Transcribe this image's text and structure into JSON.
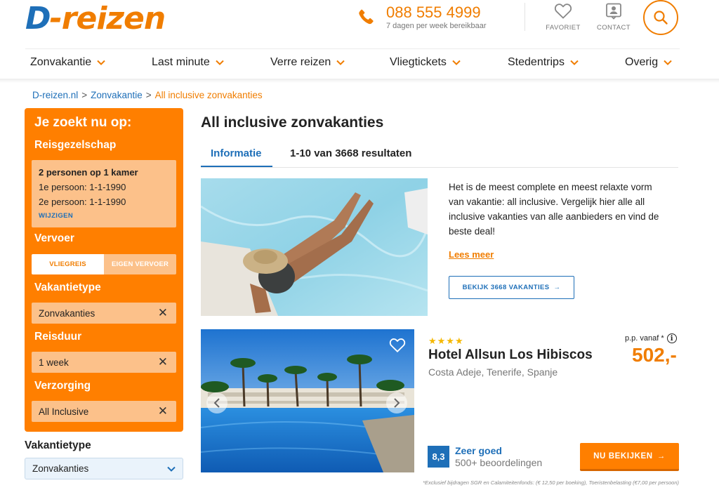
{
  "header": {
    "logo_d": "D",
    "logo_rest": "-reizen",
    "phone_number": "088 555 4999",
    "phone_sub": "7 dagen per week bereikbaar",
    "favorites_label": "FAVORIET",
    "contact_label": "CONTACT",
    "icons": [
      "phone-icon",
      "heart-icon",
      "contact-icon",
      "search-icon"
    ]
  },
  "nav": {
    "items": [
      {
        "label": "Zonvakantie"
      },
      {
        "label": "Last minute"
      },
      {
        "label": "Verre reizen"
      },
      {
        "label": "Vliegtickets"
      },
      {
        "label": "Stedentrips"
      },
      {
        "label": "Overig"
      }
    ]
  },
  "breadcrumb": {
    "items": [
      "D-reizen.nl",
      "Zonvakantie",
      "All inclusive zonvakanties"
    ],
    "separator": ">"
  },
  "sidebar": {
    "heading": "Je zoekt nu op:",
    "party": {
      "title": "Reisgezelschap",
      "summary": "2 personen op 1 kamer",
      "person1": "1e persoon: 1-1-1990",
      "person2": "2e persoon: 1-1-1990",
      "change_label": "WIJZIGEN"
    },
    "transport": {
      "title": "Vervoer",
      "options": [
        "VLIEGREIS",
        "EIGEN VERVOER"
      ],
      "selected": "VLIEGREIS"
    },
    "vacation_type": {
      "title": "Vakantietype",
      "value": "Zonvakanties"
    },
    "duration": {
      "title": "Reisduur",
      "value": "1 week"
    },
    "board": {
      "title": "Verzorging",
      "value": "All Inclusive"
    },
    "remove_glyph": "✕"
  },
  "vacation_type_select": {
    "label": "Vakantietype",
    "selected": "Zonvakanties"
  },
  "main": {
    "title": "All inclusive zonvakanties",
    "tabs": [
      {
        "label": "Informatie",
        "active": true
      },
      {
        "label": "1-10 van 3668 resultaten",
        "active": false
      }
    ],
    "intro_text": "Het is de meest complete en meest relaxte vorm van vakantie: all inclusive. Vergelijk hier alle all inclusive vakanties van alle aanbieders en vind de beste deal!",
    "read_more": "Lees meer",
    "view_button": "BEKIJK 3668 VAKANTIES",
    "arrow_glyph": "→"
  },
  "hotel": {
    "stars": "★★★★",
    "star_count": 4,
    "name": "Hotel Allsun Los Hibiscos",
    "location": "Costa Adeje, Tenerife, Spanje",
    "price_label": "p.p. vanaf *",
    "info_glyph": "i",
    "price": "502,-",
    "rating_score": "8,3",
    "rating_text": "Zeer goed",
    "review_count": "500+ beoordelingen",
    "cta": "NU BEKIJKEN"
  },
  "footnote": "*Exclusief bijdragen SGR en Calamiteitenfonds: (€ 12,50 per boeking), Toeristenbelasting (€7,00 per persoon)",
  "colors": {
    "brand_orange": "#f07d00",
    "brand_blue": "#1e6fb8",
    "sidebar_bg": "#ff7f00",
    "sidebar_box": "#fcc18a",
    "star_yellow": "#f5b800"
  }
}
